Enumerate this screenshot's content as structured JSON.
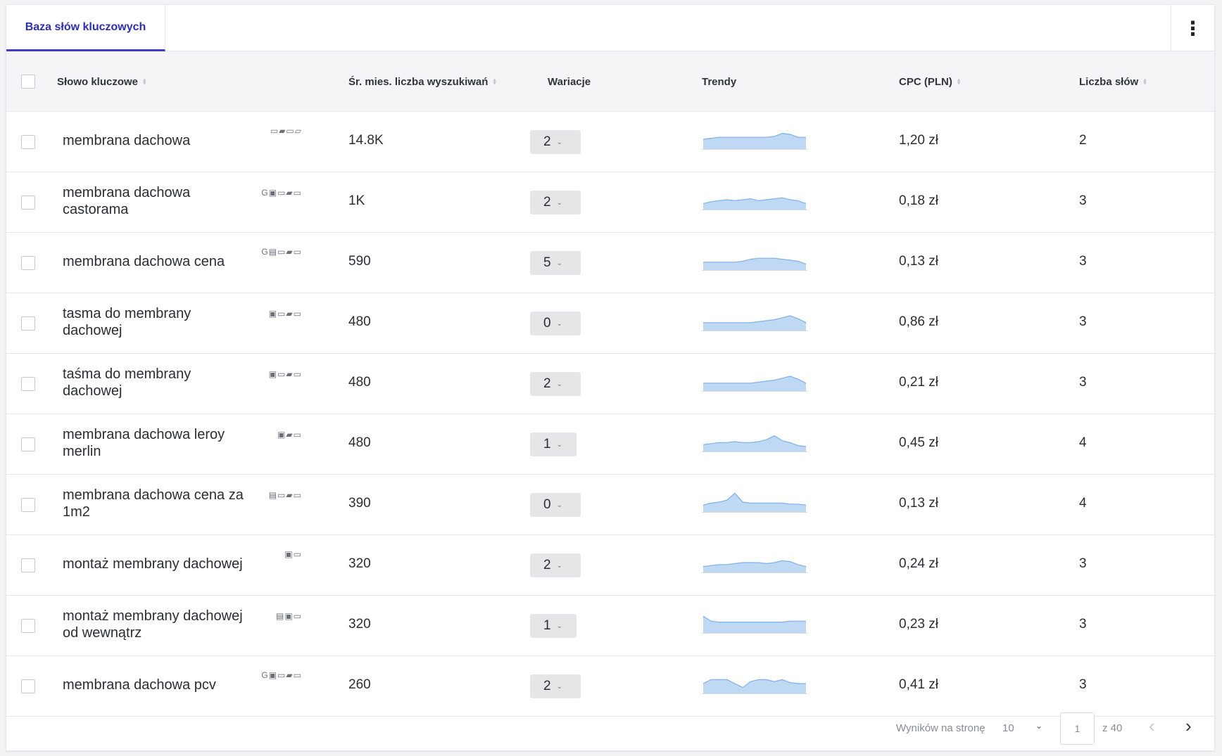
{
  "tabs": [
    {
      "label": "Baza słów kluczowych",
      "active": true
    }
  ],
  "columns": {
    "keyword": "Słowo kluczowe",
    "volume": "Śr. mies. liczba wyszukiwań",
    "variations": "Wariacje",
    "trends": "Trendy",
    "cpc": "CPC (PLN)",
    "word_count": "Liczba słów"
  },
  "accent": "#3b3dc4",
  "trend_color": "#bfd9f5",
  "trend_stroke": "#7fb0e6",
  "rows": [
    {
      "keyword": "membrana dachowa",
      "features": "▭▰▭▱",
      "volume": "14.8K",
      "variations": "2",
      "trend": [
        0.5,
        0.55,
        0.6,
        0.6,
        0.6,
        0.6,
        0.6,
        0.6,
        0.6,
        0.65,
        0.8,
        0.75,
        0.6,
        0.6
      ],
      "cpc": "1,20 zł",
      "words": "2"
    },
    {
      "keyword": "membrana dachowa castorama",
      "features": "G▣▭▰▭",
      "volume": "1K",
      "variations": "2",
      "trend": [
        0.3,
        0.4,
        0.45,
        0.5,
        0.45,
        0.5,
        0.55,
        0.45,
        0.5,
        0.55,
        0.6,
        0.5,
        0.45,
        0.3
      ],
      "cpc": "0,18 zł",
      "words": "3"
    },
    {
      "keyword": "membrana dachowa cena",
      "features": "G▤▭▰▭",
      "volume": "590",
      "variations": "5",
      "trend": [
        0.4,
        0.4,
        0.4,
        0.4,
        0.4,
        0.45,
        0.55,
        0.6,
        0.6,
        0.6,
        0.55,
        0.5,
        0.45,
        0.3
      ],
      "cpc": "0,13 zł",
      "words": "3"
    },
    {
      "keyword": "tasma do membrany dachowej",
      "features": "▣▭▰▭",
      "volume": "480",
      "variations": "0",
      "trend": [
        0.4,
        0.4,
        0.4,
        0.4,
        0.4,
        0.4,
        0.4,
        0.45,
        0.5,
        0.55,
        0.65,
        0.75,
        0.6,
        0.4
      ],
      "cpc": "0,86 zł",
      "words": "3"
    },
    {
      "keyword": "taśma do membrany dachowej",
      "features": "▣▭▰▭",
      "volume": "480",
      "variations": "2",
      "trend": [
        0.4,
        0.4,
        0.4,
        0.4,
        0.4,
        0.4,
        0.4,
        0.45,
        0.5,
        0.55,
        0.65,
        0.75,
        0.6,
        0.4
      ],
      "cpc": "0,21 zł",
      "words": "3"
    },
    {
      "keyword": "membrana dachowa leroy merlin",
      "features": "▣▰▭",
      "volume": "480",
      "variations": "1",
      "trend": [
        0.35,
        0.4,
        0.45,
        0.45,
        0.5,
        0.45,
        0.45,
        0.5,
        0.6,
        0.8,
        0.55,
        0.45,
        0.3,
        0.25
      ],
      "cpc": "0,45 zł",
      "words": "4"
    },
    {
      "keyword": "membrana dachowa cena za 1m2",
      "features": "▤▭▰▭",
      "volume": "390",
      "variations": "0",
      "trend": [
        0.35,
        0.45,
        0.5,
        0.6,
        0.95,
        0.5,
        0.45,
        0.45,
        0.45,
        0.45,
        0.45,
        0.4,
        0.4,
        0.35
      ],
      "cpc": "0,13 zł",
      "words": "4"
    },
    {
      "keyword": "montaż membrany dachowej",
      "features": "▣▭",
      "volume": "320",
      "variations": "2",
      "trend": [
        0.3,
        0.35,
        0.4,
        0.4,
        0.45,
        0.5,
        0.5,
        0.5,
        0.45,
        0.5,
        0.6,
        0.55,
        0.4,
        0.3
      ],
      "cpc": "0,24 zł",
      "words": "3"
    },
    {
      "keyword": "montaż membrany dachowej od wewnątrz",
      "features": "▤▣▭",
      "volume": "320",
      "variations": "1",
      "trend": [
        0.85,
        0.6,
        0.55,
        0.55,
        0.55,
        0.55,
        0.55,
        0.55,
        0.55,
        0.55,
        0.55,
        0.6,
        0.6,
        0.6
      ],
      "cpc": "0,23 zł",
      "words": "3"
    },
    {
      "keyword": "membrana dachowa pcv",
      "features": "G▣▭▰▭",
      "volume": "260",
      "variations": "2",
      "trend": [
        0.5,
        0.7,
        0.7,
        0.7,
        0.5,
        0.3,
        0.6,
        0.7,
        0.7,
        0.6,
        0.7,
        0.55,
        0.5,
        0.5
      ],
      "cpc": "0,41 zł",
      "words": "3"
    }
  ],
  "pagination": {
    "per_page_label": "Wyników na stronę",
    "per_page_value": "10",
    "current_page": "1",
    "of_label": "z 40"
  }
}
